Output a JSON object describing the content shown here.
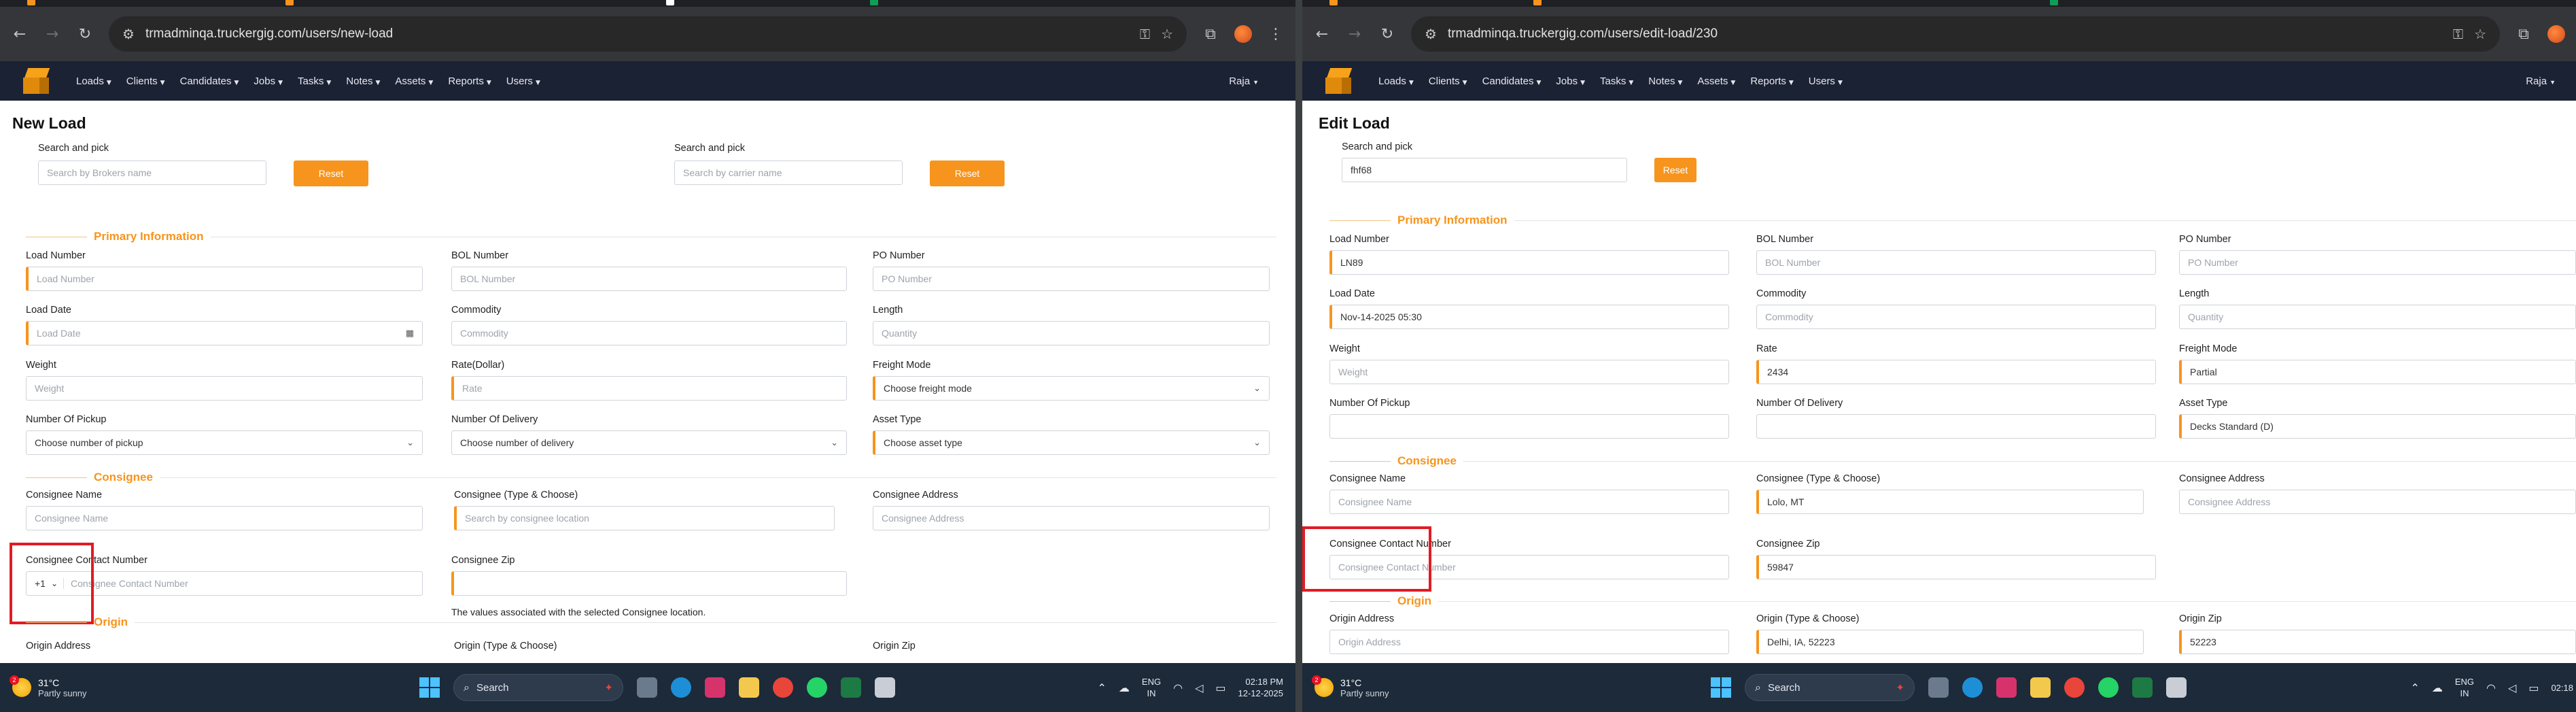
{
  "left": {
    "url": "trmadminqa.truckergig.com/users/new-load",
    "nav": {
      "menu": [
        "Loads",
        "Clients",
        "Candidates",
        "Jobs",
        "Tasks",
        "Notes",
        "Assets",
        "Reports",
        "Users"
      ],
      "user": "Raja"
    },
    "title": "New Load",
    "search": {
      "label1": "Search and pick",
      "broker_placeholder": "Search by Brokers name",
      "reset1": "Reset",
      "label2": "Search and pick",
      "carrier_placeholder": "Search by carrier name",
      "reset2": "Reset"
    },
    "primary": {
      "heading": "Primary Information",
      "load_number": {
        "label": "Load Number",
        "placeholder": "Load Number"
      },
      "bol_number": {
        "label": "BOL Number",
        "placeholder": "BOL Number"
      },
      "po_number": {
        "label": "PO Number",
        "placeholder": "PO Number"
      },
      "load_date": {
        "label": "Load Date",
        "placeholder": "Load Date"
      },
      "commodity": {
        "label": "Commodity",
        "placeholder": "Commodity"
      },
      "length": {
        "label": "Length",
        "placeholder": "Quantity"
      },
      "weight": {
        "label": "Weight",
        "placeholder": "Weight"
      },
      "rate": {
        "label": "Rate(Dollar)",
        "placeholder": "Rate"
      },
      "freight_mode": {
        "label": "Freight Mode",
        "value": "Choose freight mode"
      },
      "pickup": {
        "label": "Number Of Pickup",
        "value": "Choose number of pickup"
      },
      "delivery": {
        "label": "Number Of Delivery",
        "value": "Choose number of delivery"
      },
      "asset_type": {
        "label": "Asset Type",
        "value": "Choose asset type"
      }
    },
    "consignee": {
      "heading": "Consignee",
      "name": {
        "label": "Consignee Name",
        "placeholder": "Consignee Name"
      },
      "type_choose": {
        "label": "Consignee (Type & Choose)",
        "placeholder": "Search by consignee location"
      },
      "address": {
        "label": "Consignee Address",
        "placeholder": "Consignee Address"
      },
      "contact": {
        "label": "Consignee Contact Number",
        "code": "+1",
        "placeholder": "Consignee Contact Number"
      },
      "zip": {
        "label": "Consignee Zip",
        "value": ""
      },
      "hint": "The values associated with the selected Consignee location."
    },
    "origin": {
      "heading": "Origin",
      "address_label": "Origin Address",
      "type_label": "Origin (Type & Choose)",
      "zip_label": "Origin Zip"
    }
  },
  "right": {
    "url": "trmadminqa.truckergig.com/users/edit-load/230",
    "nav": {
      "menu": [
        "Loads",
        "Clients",
        "Candidates",
        "Jobs",
        "Tasks",
        "Notes",
        "Assets",
        "Reports",
        "Users"
      ],
      "user": "Raja"
    },
    "title": "Edit Load",
    "search": {
      "label": "Search and pick",
      "value": "fhf68",
      "reset": "Reset"
    },
    "primary": {
      "heading": "Primary Information",
      "load_number": {
        "label": "Load Number",
        "value": "LN89"
      },
      "bol_number": {
        "label": "BOL Number",
        "placeholder": "BOL Number"
      },
      "po_number": {
        "label": "PO Number",
        "placeholder": "PO Number"
      },
      "load_date": {
        "label": "Load Date",
        "value": "Nov-14-2025 05:30"
      },
      "commodity": {
        "label": "Commodity",
        "placeholder": "Commodity"
      },
      "length": {
        "label": "Length",
        "placeholder": "Quantity"
      },
      "weight": {
        "label": "Weight",
        "placeholder": "Weight"
      },
      "rate": {
        "label": "Rate",
        "value": "2434"
      },
      "freight_mode": {
        "label": "Freight Mode",
        "value": "Partial"
      },
      "pickup": {
        "label": "Number Of Pickup",
        "value": ""
      },
      "delivery": {
        "label": "Number Of Delivery",
        "value": ""
      },
      "asset_type": {
        "label": "Asset Type",
        "value": "Decks Standard (D)"
      }
    },
    "consignee": {
      "heading": "Consignee",
      "name": {
        "label": "Consignee Name",
        "placeholder": "Consignee Name"
      },
      "type_choose": {
        "label": "Consignee (Type & Choose)",
        "value": "Lolo, MT"
      },
      "address": {
        "label": "Consignee Address",
        "placeholder": "Consignee Address"
      },
      "contact": {
        "label": "Consignee Contact Number",
        "placeholder": "Consignee Contact Number"
      },
      "zip": {
        "label": "Consignee Zip",
        "value": "59847"
      }
    },
    "origin": {
      "heading": "Origin",
      "address": {
        "label": "Origin Address",
        "placeholder": "Origin Address"
      },
      "type_choose": {
        "label": "Origin (Type & Choose)",
        "value": "Delhi, IA, 52223"
      },
      "zip": {
        "label": "Origin Zip",
        "value": "52223"
      }
    }
  },
  "taskbar": {
    "temp": "31°C",
    "condition": "Partly sunny",
    "notif_badge": "2",
    "search": "Search",
    "lang1": "ENG",
    "lang2": "IN",
    "time": "02:18 PM",
    "date": "12-12-2025",
    "time_right": "02:18"
  },
  "colors": {
    "accent": "#f7941d",
    "navbar": "#1b2233",
    "highlight": "#e01b24",
    "taskbar": "#1c2a3a"
  }
}
